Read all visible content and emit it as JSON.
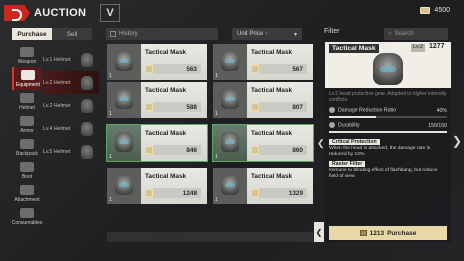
{
  "header": {
    "title": "AUCTION",
    "v_label": "V",
    "currency_amount": "4500"
  },
  "tabs": [
    {
      "label": "Purchase",
      "active": true
    },
    {
      "label": "Sell",
      "active": false
    }
  ],
  "categories": [
    {
      "label": "Weapon",
      "icon": "rifle-icon",
      "active": false
    },
    {
      "label": "Equipment",
      "icon": "helmet-icon",
      "active": true
    },
    {
      "label": "Helmet",
      "icon": "helmet-icon",
      "active": false
    },
    {
      "label": "Armor",
      "icon": "armor-icon",
      "active": false
    },
    {
      "label": "Backpack",
      "icon": "backpack-icon",
      "active": false
    },
    {
      "label": "Boot",
      "icon": "boot-icon",
      "active": false
    },
    {
      "label": "Attachment",
      "icon": "attachment-icon",
      "active": false
    },
    {
      "label": "Consumables",
      "icon": "consumable-icon",
      "active": false
    }
  ],
  "subcategories": [
    {
      "label": "Lv.1 Helmet",
      "active": false
    },
    {
      "label": "Lv.2 Helmet",
      "active": true
    },
    {
      "label": "Lv.2 Helmet",
      "active": false
    },
    {
      "label": "Lv.4 Helmet",
      "active": false
    },
    {
      "label": "Lv.5 Helmet",
      "active": false
    }
  ],
  "toolbar": {
    "history_label": "History",
    "sort_label": "Unit Price ↑",
    "filter_label": "Filter",
    "search_placeholder": "Search"
  },
  "listings": [
    {
      "name": "Tactical Mask",
      "qty": "1",
      "price": "563"
    },
    {
      "name": "Tactical Mask",
      "qty": "1",
      "price": "567"
    },
    {
      "name": "Tactical Mask",
      "qty": "1",
      "price": "588"
    },
    {
      "name": "Tactical Mask",
      "qty": "1",
      "price": "807"
    },
    {
      "name": "Tactical Mask",
      "qty": "1",
      "price": "846"
    },
    {
      "name": "Tactical Mask",
      "qty": "1",
      "price": "860"
    },
    {
      "name": "Tactical Mask",
      "qty": "1",
      "price": "1248"
    },
    {
      "name": "Tactical Mask",
      "qty": "1",
      "price": "1329"
    }
  ],
  "detail": {
    "name": "Tactical Mask",
    "level": "Lv.2",
    "price": "1277",
    "description": "Lv.2 head protective gear. Adapted to higher intensity conflicts.",
    "stats": [
      {
        "label": "Damage Reduction Ratio",
        "value": "40%",
        "fill": 0.4
      },
      {
        "label": "Durability",
        "value": "150/150",
        "fill": 1.0
      }
    ],
    "effects": [
      {
        "title": "Critical Protection",
        "text": "When the head is attacked, the damage rate is reduced by 12%."
      },
      {
        "title": "Raster Filter",
        "text": "Immune to blinding effect of flashbang, but reduce field of view."
      }
    ],
    "buy_price": "1213",
    "buy_label": "Purchase"
  },
  "colors": {
    "accent_red": "#c8281e",
    "card_bg": "#e9e8e2",
    "buy_button": "#e8d8a8"
  }
}
